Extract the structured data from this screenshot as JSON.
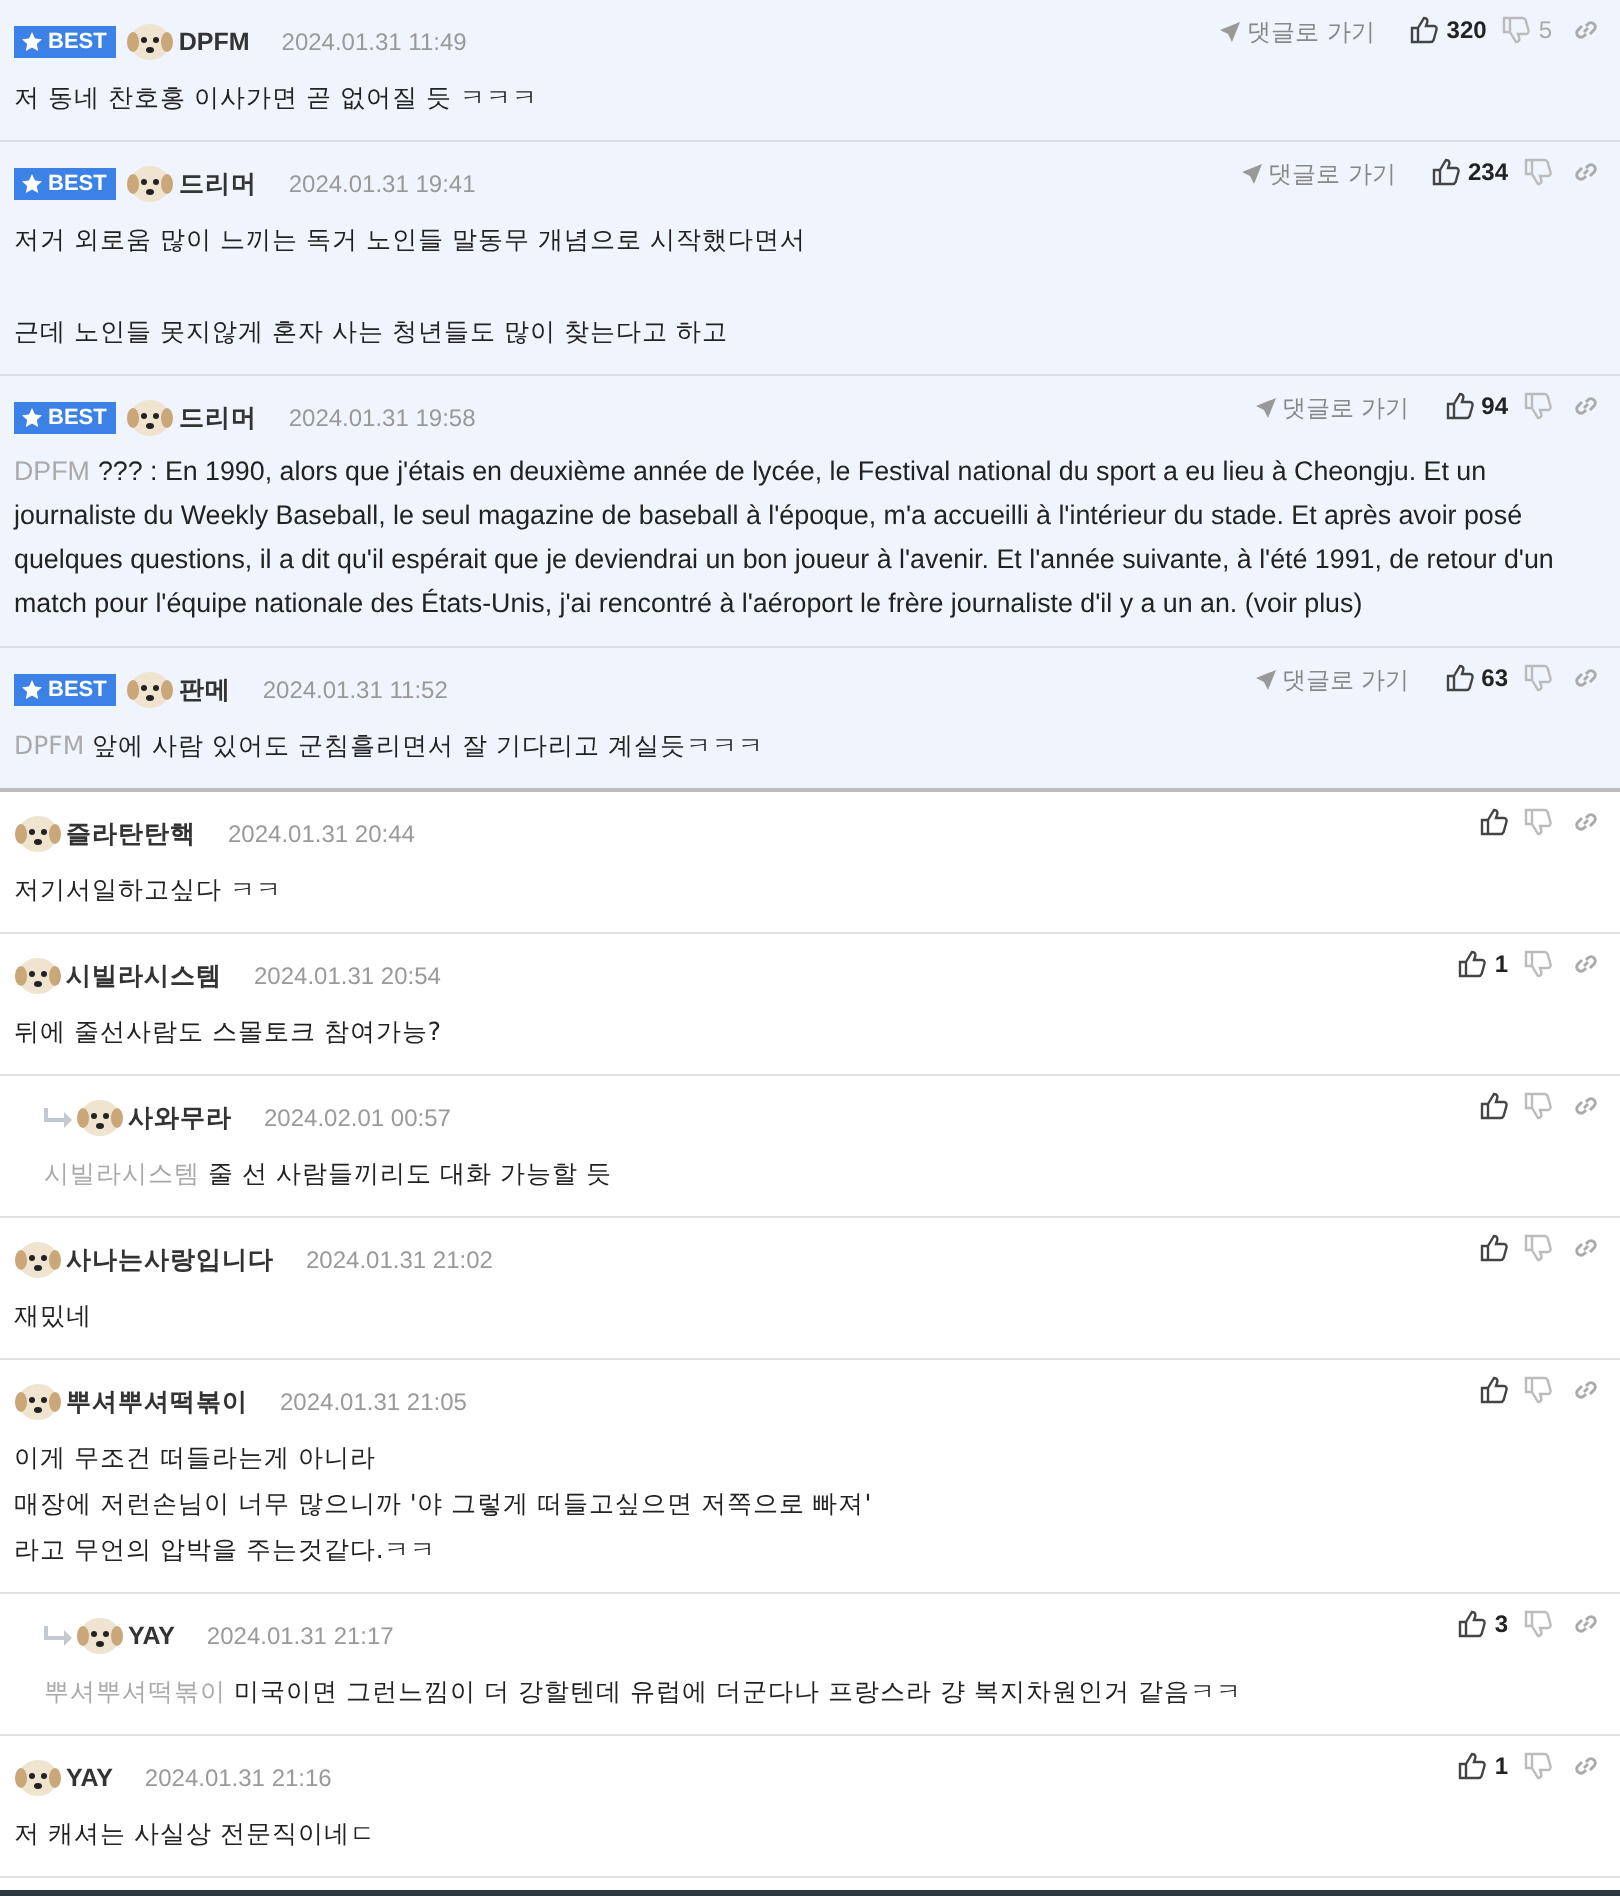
{
  "comments": [
    {
      "best": true,
      "badge": "BEST",
      "reply": false,
      "author": "DPFM",
      "date": "2024.01.31 11:49",
      "goto": "댓글로 가기",
      "likes": "320",
      "dislikes": "5",
      "paragraphs": [
        [
          "저 동네 찬호홍 이사가면 곧 없어질 듯 ㅋㅋㅋ"
        ]
      ]
    },
    {
      "best": true,
      "badge": "BEST",
      "reply": false,
      "author": "드리머",
      "date": "2024.01.31 19:41",
      "goto": "댓글로 가기",
      "likes": "234",
      "paragraphs": [
        [
          "저거 외로움 많이 느끼는 독거 노인들 말동무 개념으로 시작했다면서"
        ],
        [
          "근데 노인들 못지않게 혼자 사는 청년들도 많이 찾는다고 하고"
        ]
      ]
    },
    {
      "best": true,
      "badge": "BEST",
      "reply": false,
      "author": "드리머",
      "date": "2024.01.31 19:58",
      "goto": "댓글로 가기",
      "likes": "94",
      "mention": "DPFM",
      "paragraphs": [
        [
          "??? : En 1990, alors que j'étais en deuxième année de lycée, le Festival national du sport a eu lieu à Cheongju. Et un journaliste du Weekly Baseball, le seul magazine de baseball à l'époque, m'a accueilli à l'intérieur du stade. Et après avoir posé quelques questions, il a dit qu'il espérait que je deviendrai un bon joueur à l'avenir. Et l'année suivante, à l'été 1991, de retour d'un match pour l'équipe nationale des États-Unis, j'ai rencontré à l'aéroport le frère journaliste d'il y a un an. (voir plus)"
        ]
      ]
    },
    {
      "best": true,
      "badge": "BEST",
      "reply": false,
      "author": "판메",
      "date": "2024.01.31 11:52",
      "goto": "댓글로 가기",
      "likes": "63",
      "mention": "DPFM",
      "paragraphs": [
        [
          "앞에 사람 있어도 군침흘리면서 잘 기다리고 계실듯ㅋㅋㅋ"
        ]
      ]
    },
    {
      "best": false,
      "reply": false,
      "author": "즐라탄탄핵",
      "date": "2024.01.31 20:44",
      "paragraphs": [
        [
          "저기서일하고싶다 ㅋㅋ"
        ]
      ]
    },
    {
      "best": false,
      "reply": false,
      "author": "시빌라시스템",
      "date": "2024.01.31 20:54",
      "likes": "1",
      "paragraphs": [
        [
          "뒤에 줄선사람도 스몰토크 참여가능?"
        ]
      ]
    },
    {
      "best": false,
      "reply": true,
      "author": "사와무라",
      "date": "2024.02.01 00:57",
      "mention": "시빌라시스템",
      "paragraphs": [
        [
          "줄 선 사람들끼리도 대화 가능할 듯"
        ]
      ]
    },
    {
      "best": false,
      "reply": false,
      "author": "사나는사랑입니다",
      "date": "2024.01.31 21:02",
      "paragraphs": [
        [
          "재밌네"
        ]
      ]
    },
    {
      "best": false,
      "reply": false,
      "author": "뿌셔뿌셔떡볶이",
      "date": "2024.01.31 21:05",
      "paragraphs": [
        [
          "이게 무조건 떠들라는게 아니라",
          "매장에 저런손님이 너무 많으니까 '야 그렇게 떠들고싶으면 저쪽으로 빠져'",
          "라고 무언의 압박을 주는것같다.ㅋㅋ"
        ]
      ]
    },
    {
      "best": false,
      "reply": true,
      "author": "YAY",
      "date": "2024.01.31 21:17",
      "likes": "3",
      "mention": "뿌셔뿌셔떡볶이",
      "paragraphs": [
        [
          "미국이면 그런느낌이 더 강할텐데 유럽에 더군다나 프랑스라 걍 복지차원인거 같음ㅋㅋ"
        ]
      ]
    },
    {
      "best": false,
      "reply": false,
      "author": "YAY",
      "date": "2024.01.31 21:16",
      "likes": "1",
      "paragraphs": [
        [
          "저 캐셔는 사실상 전문직이네ㄷ"
        ]
      ]
    }
  ]
}
